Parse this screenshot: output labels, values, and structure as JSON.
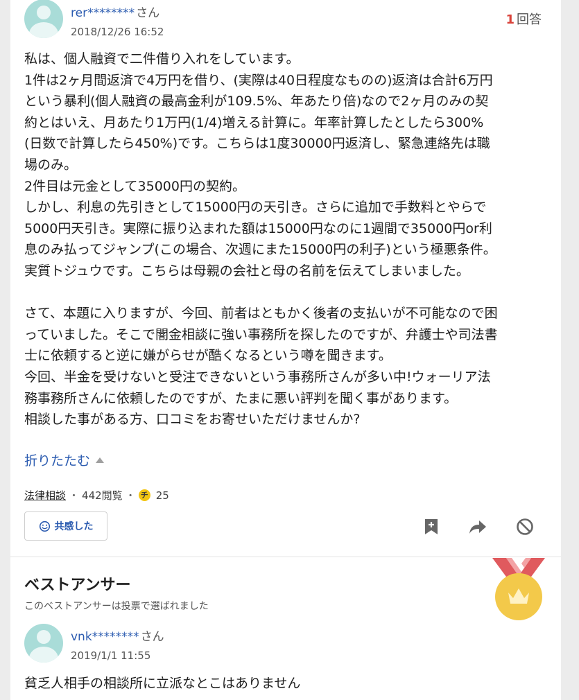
{
  "question": {
    "user": {
      "name": "rer********",
      "honorific": "さん"
    },
    "date": "2018/12/26 16:52",
    "answer_count": "1",
    "answer_count_label": "回答",
    "body_lines": [
      "私は、個人融資で二件借り入れをしています。",
      "1件は2ヶ月間返済で4万円を借り、(実際は40日程度なものの)返済は合計6万円",
      "という暴利(個人融資の最高金利が109.5%、年あたり倍)なので2ヶ月のみの契",
      "約とはいえ、月あたり1万円(1/4)増える計算に。年率計算したとしたら300%",
      "(日数で計算したら450%)です。こちらは1度30000円返済し、緊急連絡先は職",
      "場のみ。",
      "2件目は元金として35000円の契約。",
      "しかし、利息の先引きとして15000円の天引き。さらに追加で手数料とやらで",
      "5000円天引き。実際に振り込まれた額は15000円なのに1週間で35000円or利",
      "息のみ払ってジャンプ(この場合、次週にまた15000円の利子)という極悪条件。",
      "実質トジュウです。こちらは母親の会社と母の名前を伝えてしまいました。",
      "",
      "さて、本題に入りますが、今回、前者はともかく後者の支払いが不可能なので困",
      "っていました。そこで闇金相談に強い事務所を探したのですが、弁護士や司法書",
      "士に依頼すると逆に嫌がらせが酷くなるという噂を聞きます。",
      "今回、半金を受けないと受注できないという事務所さんが多い中!ウォーリア法",
      "務事務所さんに依頼したのですが、たまに悪い評判を聞く事があります。",
      "相談した事がある方、口コミをお寄せいただけませんか?"
    ],
    "fold_label": "折りたたむ",
    "category": "法律相談",
    "views": "442閲覧",
    "coin_label": "チ",
    "coins": "25",
    "empathy_label": "共感した"
  },
  "icons": {
    "avatar": "user-avatar-icon",
    "smile": "smile-icon",
    "bookmark": "bookmark-plus-icon",
    "share": "share-arrow-icon",
    "block": "prohibited-icon",
    "medal": "crown-medal-icon"
  },
  "colors": {
    "link": "#2b5bb0",
    "answer_count": "#d9433b",
    "avatar": "#a9dcd8",
    "medal_gold": "#f3c94a",
    "medal_ribbon": "#e05a5e",
    "coin": "#f3c512"
  },
  "best_answer": {
    "title": "ベストアンサー",
    "subtitle": "このベストアンサーは投票で選ばれました",
    "user": {
      "name": "vnk********",
      "honorific": "さん"
    },
    "date": "2019/1/1 11:55",
    "body": "貧乏人相手の相談所に立派なとこはありません"
  }
}
